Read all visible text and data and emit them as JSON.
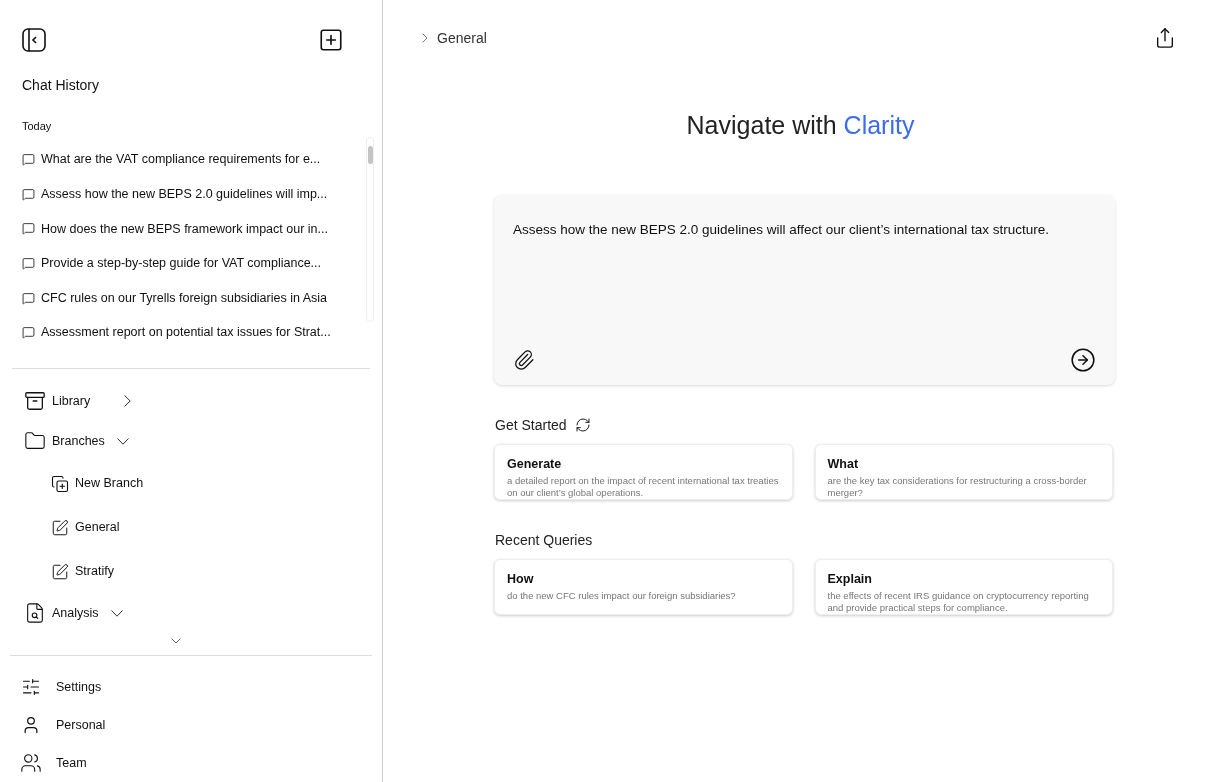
{
  "sidebar": {
    "title": "Chat History",
    "section_label": "Today",
    "history": [
      {
        "text": "What are the VAT compliance requirements for e..."
      },
      {
        "text": "Assess how the new BEPS 2.0 guidelines will imp..."
      },
      {
        "text": "How does the new BEPS framework impact our in..."
      },
      {
        "text": "Provide a step-by-step guide for VAT compliance..."
      },
      {
        "text": "CFC rules on our Tyrells foreign subsidiaries in Asia"
      },
      {
        "text": "Assessment report on potential tax issues for Strat..."
      }
    ],
    "nav": [
      {
        "kind": "library",
        "label": "Library",
        "expanded": false
      },
      {
        "kind": "folder",
        "label": "Branches",
        "expanded": true,
        "children": [
          {
            "kind": "new",
            "label": "New Branch"
          },
          {
            "kind": "edit",
            "label": "General"
          },
          {
            "kind": "edit",
            "label": "Stratify"
          }
        ]
      },
      {
        "kind": "analysis",
        "label": "Analysis",
        "expanded": true
      }
    ],
    "bottom": [
      {
        "kind": "settings",
        "label": "Settings"
      },
      {
        "kind": "personal",
        "label": "Personal"
      },
      {
        "kind": "team",
        "label": "Team"
      }
    ]
  },
  "main": {
    "breadcrumb": "General",
    "heading": "Navigate with",
    "heading_accent": "Clarity",
    "prompt": {
      "value": "Assess how the new BEPS 2.0 guidelines will affect our client’s international tax structure."
    },
    "sections": [
      {
        "title": "Get Started",
        "refresh": true,
        "cards": [
          {
            "title": "Generate",
            "text": "a detailed report on the impact of recent international tax treaties on our client’s global operations."
          },
          {
            "title": "What",
            "text": "are the key tax considerations for restructuring a cross-border merger?"
          }
        ]
      },
      {
        "title": "Recent Queries",
        "refresh": false,
        "cards": [
          {
            "title": "How",
            "text": "do the new CFC rules impact our foreign subsidiaries?"
          },
          {
            "title": "Explain",
            "text": "the effects of recent IRS guidance on cryptocurrency reporting and provide practical steps for compliance."
          }
        ]
      }
    ]
  }
}
